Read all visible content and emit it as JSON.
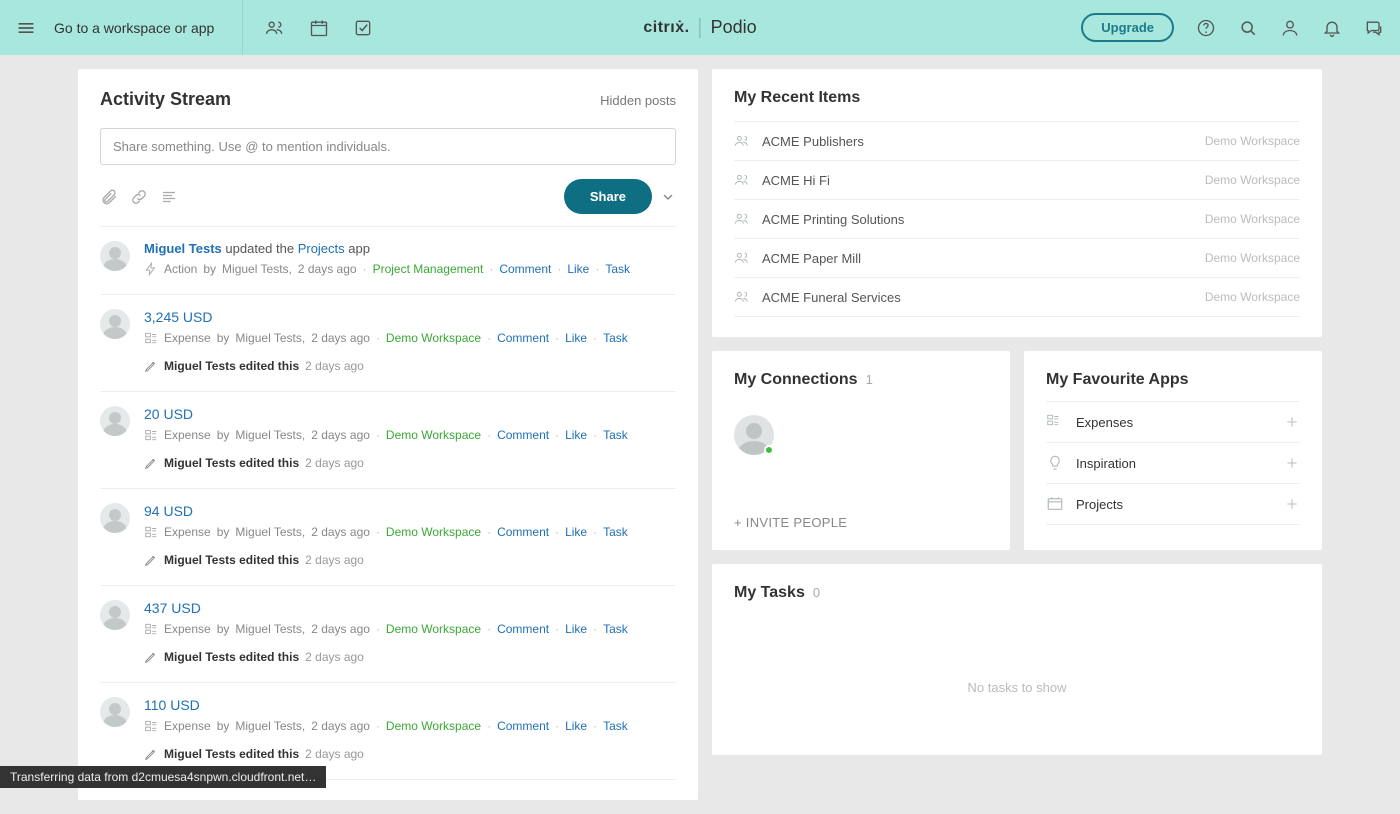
{
  "header": {
    "goto": "Go to a workspace or app",
    "brand_left": "citrıẋ.",
    "brand_right": "Podio",
    "upgrade": "Upgrade"
  },
  "activity": {
    "title": "Activity Stream",
    "hidden": "Hidden posts",
    "composer_placeholder": "Share something. Use @ to mention individuals.",
    "share": "Share"
  },
  "feed": [
    {
      "user": "Miguel Tests",
      "verb": " updated the ",
      "object": "Projects",
      "suffix": " app",
      "type": "Action",
      "by": "by",
      "author": "Miguel Tests",
      "time": "2 days ago",
      "workspace": "Project Management",
      "actions": {
        "comment": "Comment",
        "like": "Like",
        "task": "Task"
      }
    },
    {
      "title": "3,245 USD",
      "type": "Expense",
      "by": "by",
      "author": "Miguel Tests",
      "time": "2 days ago",
      "workspace": "Demo Workspace",
      "actions": {
        "comment": "Comment",
        "like": "Like",
        "task": "Task"
      },
      "edited": {
        "who": "Miguel Tests edited this",
        "when": "2 days ago"
      }
    },
    {
      "title": "20 USD",
      "type": "Expense",
      "by": "by",
      "author": "Miguel Tests",
      "time": "2 days ago",
      "workspace": "Demo Workspace",
      "actions": {
        "comment": "Comment",
        "like": "Like",
        "task": "Task"
      },
      "edited": {
        "who": "Miguel Tests edited this",
        "when": "2 days ago"
      }
    },
    {
      "title": "94 USD",
      "type": "Expense",
      "by": "by",
      "author": "Miguel Tests",
      "time": "2 days ago",
      "workspace": "Demo Workspace",
      "actions": {
        "comment": "Comment",
        "like": "Like",
        "task": "Task"
      },
      "edited": {
        "who": "Miguel Tests edited this",
        "when": "2 days ago"
      }
    },
    {
      "title": "437 USD",
      "type": "Expense",
      "by": "by",
      "author": "Miguel Tests",
      "time": "2 days ago",
      "workspace": "Demo Workspace",
      "actions": {
        "comment": "Comment",
        "like": "Like",
        "task": "Task"
      },
      "edited": {
        "who": "Miguel Tests edited this",
        "when": "2 days ago"
      }
    },
    {
      "title": "110 USD",
      "type": "Expense",
      "by": "by",
      "author": "Miguel Tests",
      "time": "2 days ago",
      "workspace": "Demo Workspace",
      "actions": {
        "comment": "Comment",
        "like": "Like",
        "task": "Task"
      },
      "edited": {
        "who": "Miguel Tests edited this",
        "when": "2 days ago"
      }
    }
  ],
  "recent": {
    "title": "My Recent Items",
    "items": [
      {
        "name": "ACME Publishers",
        "workspace": "Demo Workspace"
      },
      {
        "name": "ACME Hi Fi",
        "workspace": "Demo Workspace"
      },
      {
        "name": "ACME Printing Solutions",
        "workspace": "Demo Workspace"
      },
      {
        "name": "ACME Paper Mill",
        "workspace": "Demo Workspace"
      },
      {
        "name": "ACME Funeral Services",
        "workspace": "Demo Workspace"
      }
    ]
  },
  "connections": {
    "title": "My Connections",
    "count": "1",
    "invite": "+ INVITE PEOPLE"
  },
  "favourites": {
    "title": "My Favourite Apps",
    "items": [
      {
        "name": "Expenses"
      },
      {
        "name": "Inspiration"
      },
      {
        "name": "Projects"
      }
    ]
  },
  "tasks": {
    "title": "My Tasks",
    "count": "0",
    "empty": "No tasks to show"
  },
  "status": "Transferring data from d2cmuesa4snpwn.cloudfront.net…"
}
